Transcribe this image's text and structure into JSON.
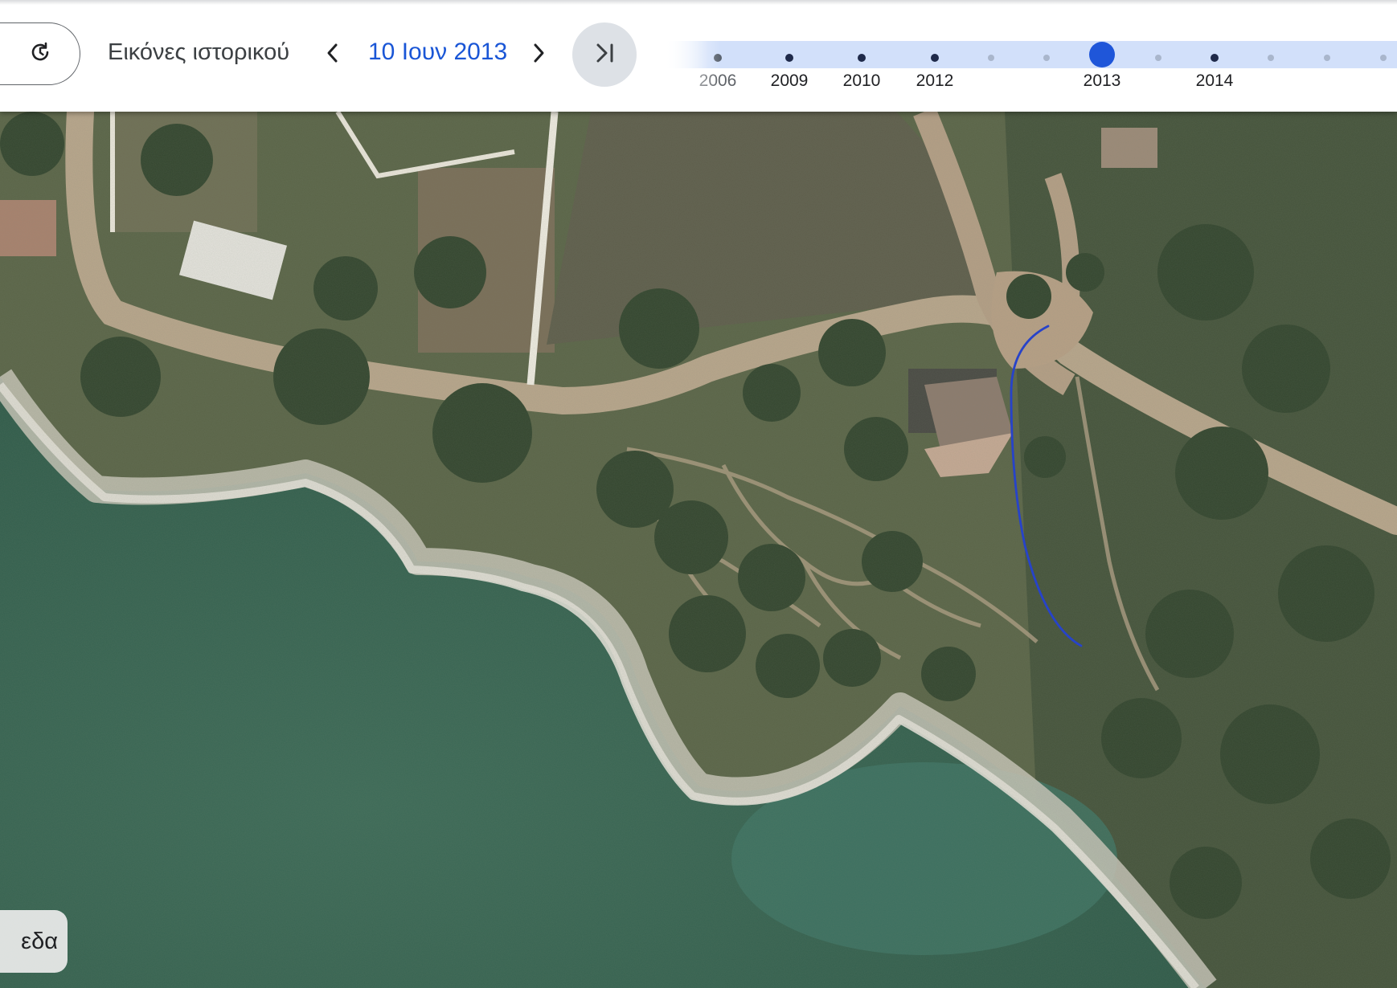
{
  "toolbar": {
    "history_icon": "history-clock-icon",
    "title": "Εικόνες ιστορικού",
    "prev_icon": "chevron-left-icon",
    "date": "10 Ιουν 2013",
    "next_icon": "chevron-right-icon",
    "latest_icon": "skip-to-latest-icon"
  },
  "timeline": {
    "years": [
      {
        "label": "2006",
        "style": "faded"
      },
      {
        "label": "2009",
        "style": "normal"
      },
      {
        "label": "2010",
        "style": "normal"
      },
      {
        "label": "2012",
        "style": "normal"
      },
      {
        "label": "2013",
        "style": "selected"
      },
      {
        "label": "2014",
        "style": "normal"
      }
    ],
    "selected_year": "2013",
    "accent_color": "#1f56d9",
    "track_color": "#d2e0fa"
  },
  "map": {
    "type": "satellite",
    "annotation_color": "#2743c9"
  },
  "layers_button": {
    "label": "εδα"
  }
}
